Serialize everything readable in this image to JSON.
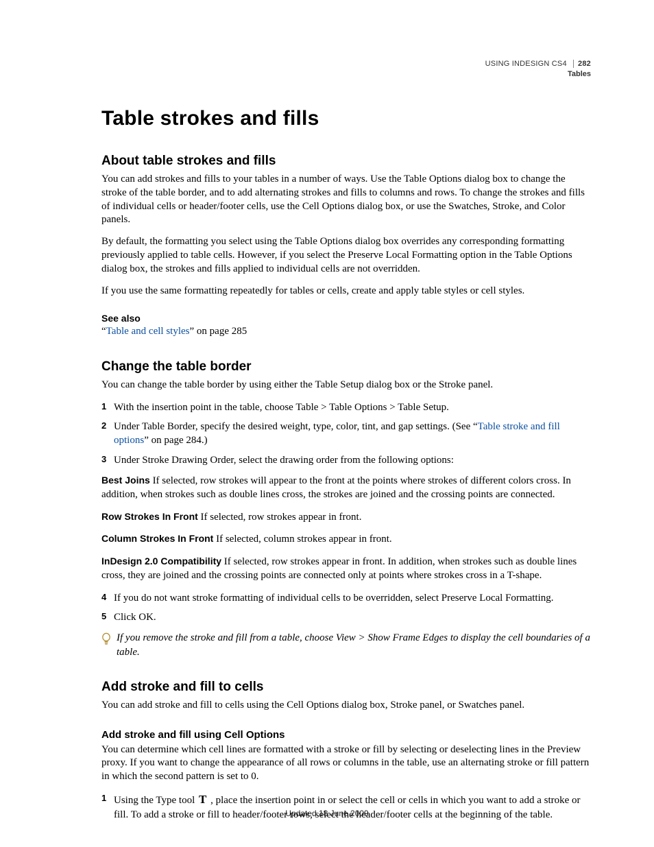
{
  "header": {
    "doc_title": "USING INDESIGN CS4",
    "section": "Tables",
    "page_number": "282"
  },
  "h1": "Table strokes and fills",
  "s1": {
    "heading": "About table strokes and fills",
    "p1": "You can add strokes and fills to your tables in a number of ways. Use the Table Options dialog box to change the stroke of the table border, and to add alternating strokes and fills to columns and rows. To change the strokes and fills of individual cells or header/footer cells, use the Cell Options dialog box, or use the Swatches, Stroke, and Color panels.",
    "p2": "By default, the formatting you select using the Table Options dialog box overrides any corresponding formatting previously applied to table cells. However, if you select the Preserve Local Formatting option in the Table Options dialog box, the strokes and fills applied to individual cells are not overridden.",
    "p3": "If you use the same formatting repeatedly for tables or cells, create and apply table styles or cell styles.",
    "see_also_label": "See also",
    "see_also_quote_open": "“",
    "see_also_link": "Table and cell styles",
    "see_also_tail": "” on page 285"
  },
  "s2": {
    "heading": "Change the table border",
    "intro": "You can change the table border by using either the Table Setup dialog box or the Stroke panel.",
    "step1": "With the insertion point in the table, choose Table > Table Options > Table Setup.",
    "step2_a": "Under Table Border, specify the desired weight, type, color, tint, and gap settings. (See “",
    "step2_link": "Table stroke and fill options",
    "step2_b": "” on page 284.)",
    "step3": "Under Stroke Drawing Order, select the drawing order from the following options:",
    "best_joins_label": "Best Joins",
    "best_joins_text": "  If selected, row strokes will appear to the front at the points where strokes of different colors cross. In addition, when strokes such as double lines cross, the strokes are joined and the crossing points are connected.",
    "row_front_label": "Row Strokes In Front",
    "row_front_text": "  If selected, row strokes appear in front.",
    "col_front_label": "Column Strokes In Front",
    "col_front_text": "  If selected, column strokes appear in front.",
    "compat_label": "InDesign 2.0 Compatibility",
    "compat_text": "  If selected, row strokes appear in front. In addition, when strokes such as double lines cross, they are joined and the crossing points are connected only at points where strokes cross in a T-shape.",
    "step4": "If you do not want stroke formatting of individual cells to be overridden, select Preserve Local Formatting.",
    "step5": "Click OK.",
    "tip": "If you remove the stroke and fill from a table, choose View > Show Frame Edges to display the cell boundaries of a table."
  },
  "s3": {
    "heading": "Add stroke and fill to cells",
    "intro": "You can add stroke and fill to cells using the Cell Options dialog box, Stroke panel, or Swatches panel.",
    "sub_heading": "Add stroke and fill using Cell Options",
    "sub_p": "You can determine which cell lines are formatted with a stroke or fill by selecting or deselecting lines in the Preview proxy. If you want to change the appearance of all rows or columns in the table, use an alternating stroke or fill pattern in which the second pattern is set to 0.",
    "step1_a": "Using the Type tool ",
    "step1_glyph": "T",
    "step1_b": " , place the insertion point in or select the cell or cells in which you want to add a stroke or fill. To add a stroke or fill to header/footer rows, select the header/footer cells at the beginning of the table."
  },
  "footer": "Updated 18 June 2009"
}
